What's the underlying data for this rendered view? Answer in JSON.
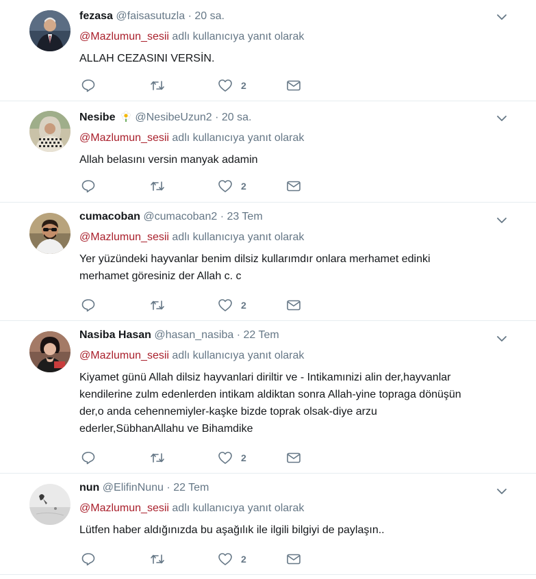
{
  "reply_prefix_suffix": "adlı kullanıcıya yanıt olarak",
  "tweets": [
    {
      "name": "fezasa",
      "handle": "@faisasutuzla",
      "separator": "·",
      "time": "20 sa.",
      "reply_to": "@Mazlumun_sesii",
      "text": "ALLAH CEZASINI VERSİN.",
      "likes": "2",
      "avatar_icon": "person-in-suit-avatar"
    },
    {
      "name": "Nesibe",
      "name_emoji": "flower-icon",
      "handle": "@NesibeUzun2",
      "separator": "·",
      "time": "20 sa.",
      "reply_to": "@Mazlumun_sesii",
      "text": "Allah belasını versin manyak adamin",
      "likes": "2",
      "avatar_icon": "woman-with-keffiyeh-avatar"
    },
    {
      "name": "cumacoban",
      "handle": "@cumacoban2",
      "separator": "·",
      "time": "23 Tem",
      "reply_to": "@Mazlumun_sesii",
      "text_lines": [
        "Yer yüzündeki hayvanlar benim dilsiz kullarımdır onlara merhamet edinki",
        "merhamet göresiniz der Allah c. c"
      ],
      "likes": "2",
      "avatar_icon": "man-with-sunglasses-avatar"
    },
    {
      "name": "Nasiba Hasan",
      "handle": "@hasan_nasiba",
      "separator": "·",
      "time": "22 Tem",
      "reply_to": "@Mazlumun_sesii",
      "text_lines": [
        "Kiyamet günü Allah dilsiz hayvanlari diriltir ve - Intikamınizi alin der,hayvanlar",
        "kendilerine zulm edenlerden intikam aldiktan sonra Allah-yine topraga dönüşün",
        "der,o anda cehennemiyler-kaşke bizde toprak olsak-diye arzu",
        "ederler,SübhanAllahu ve Bihamdike"
      ],
      "likes": "2",
      "avatar_icon": "woman-portrait-avatar"
    },
    {
      "name": "nun",
      "handle": "@ElifinNunu",
      "separator": "·",
      "time": "22 Tem",
      "reply_to": "@Mazlumun_sesii",
      "text": "Lütfen haber aldığınızda bu aşağılık ile ilgili bilgiyi de paylaşın..",
      "likes": "2",
      "avatar_icon": "grey-sketch-avatar"
    }
  ],
  "colors": {
    "link": "#a91f2b",
    "muted": "#657786",
    "text": "#14171a",
    "divider": "#e6ecf0"
  }
}
